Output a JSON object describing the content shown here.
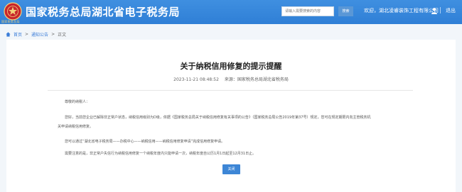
{
  "header": {
    "title": "国家税务总局湖北省电子税务局",
    "emblem_text": "国家税务总局",
    "search_placeholder": "请输入需要搜索的内容",
    "search_label": "搜索",
    "welcome": "欢迎，湖北凌睿装饰工程有限公司",
    "logout": "退出"
  },
  "breadcrumb": {
    "home": "首页",
    "sep": ">",
    "notices": "通知公告",
    "current": "正文"
  },
  "article": {
    "title": "关于纳税信用修复的提示提醒",
    "date": "2023-11-21 08:48:52",
    "source_label": "来源：",
    "source": "国家税务总局湖北省税务局",
    "paragraphs": [
      "尊敬的纳税人：",
      "您好，当前您企业已解除非正常户状态，纳税信用级别为D级，依据《国家税务总局关于纳税信用修复有关事项的公告》（国家税务总局公告2019年第37号）规定，您可在规定期限内向主管税务机",
      "关申请纳税信用修复。",
      "您可以通过“湖北省电子税务局——办税中心——纳税信用——纳税信用修复申请”完成信用修复申请。",
      "需要注意的是，非正常户失信行为纳税信用修复一个纳税年度内只能申请一次，纳税年度自公历1月1日起至12月31日止。"
    ],
    "close_label": "关闭"
  },
  "colors": {
    "header_blue": "#3a8ae0",
    "accent": "#3d86d6",
    "page_bg": "#f2f6fa"
  }
}
